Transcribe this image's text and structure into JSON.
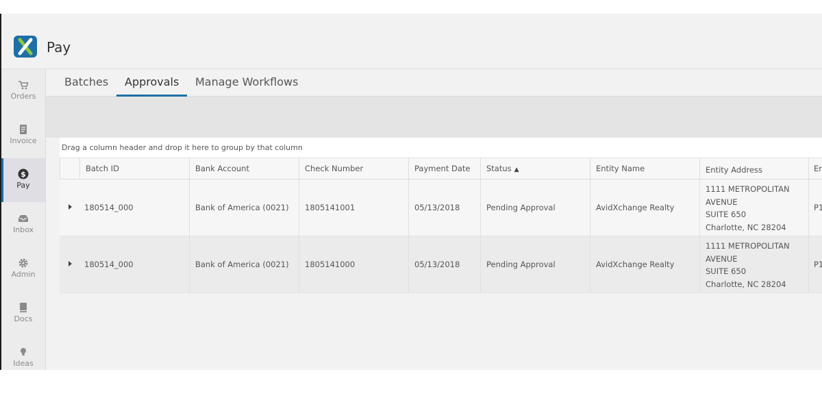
{
  "app": {
    "title": "Pay"
  },
  "sidebar": {
    "items": [
      {
        "label": "Orders",
        "icon": "cart-icon"
      },
      {
        "label": "Invoice",
        "icon": "invoice-icon"
      },
      {
        "label": "Pay",
        "icon": "dollar-icon",
        "active": true
      },
      {
        "label": "Inbox",
        "icon": "inbox-icon"
      },
      {
        "label": "Admin",
        "icon": "gear-icon"
      },
      {
        "label": "Docs",
        "icon": "docs-icon"
      },
      {
        "label": "Ideas",
        "icon": "lightbulb-icon"
      }
    ]
  },
  "tabs": [
    {
      "label": "Batches"
    },
    {
      "label": "Approvals",
      "active": true
    },
    {
      "label": "Manage Workflows"
    }
  ],
  "grid": {
    "group_hint": "Drag a column header and drop it here to group by that column",
    "columns": [
      "Batch ID",
      "Bank Account",
      "Check Number",
      "Payment Date",
      "Status",
      "Entity Name",
      "Entity Address",
      "En"
    ],
    "sort_indicator": "▲",
    "rows": [
      {
        "batch_id": "180514_000",
        "bank_account": "Bank of America (0021)",
        "check_number": "1805141001",
        "payment_date": "05/13/2018",
        "status": "Pending Approval",
        "entity_name": "AvidXchange Realty",
        "address_line1": "1111 METROPOLITAN",
        "address_line2": "AVENUE",
        "address_line3": "SUITE 650",
        "address_line4": "Charlotte, NC 28204",
        "extra": "P1"
      },
      {
        "batch_id": "180514_000",
        "bank_account": "Bank of America (0021)",
        "check_number": "1805141000",
        "payment_date": "05/13/2018",
        "status": "Pending Approval",
        "entity_name": "AvidXchange Realty",
        "address_line1": "1111 METROPOLITAN",
        "address_line2": "AVENUE",
        "address_line3": "SUITE 650",
        "address_line4": "Charlotte, NC 28204",
        "extra": "P1"
      }
    ]
  },
  "colors": {
    "accent": "#1d6fa5",
    "logo_green": "#8dc63f"
  }
}
